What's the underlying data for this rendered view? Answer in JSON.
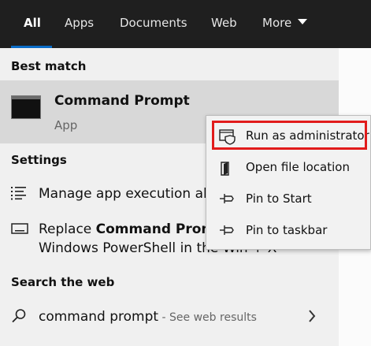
{
  "topbar": {
    "tabs": [
      "All",
      "Apps",
      "Documents",
      "Web",
      "More"
    ],
    "active_tab": "All",
    "accent_color": "#0a6cc7"
  },
  "best_match": {
    "header": "Best match",
    "title": "Command Prompt",
    "subtitle": "App",
    "icon": "command-prompt-icon"
  },
  "settings": {
    "header": "Settings",
    "items": [
      {
        "icon": "list-settings-icon",
        "text": "Manage app execution ali"
      },
      {
        "icon": "keyboard-icon",
        "text_prefix": "Replace ",
        "text_bold": "Command Promp",
        "line2": "Windows PowerShell in the Win + X"
      }
    ]
  },
  "web": {
    "header": "Search the web",
    "query": "command prompt",
    "suffix": " - See web results",
    "icon": "search-icon"
  },
  "context_menu": {
    "items": [
      {
        "label": "Run as administrator",
        "icon": "shield-window-icon",
        "highlighted": true
      },
      {
        "label": "Open file location",
        "icon": "file-location-icon"
      },
      {
        "label": "Pin to Start",
        "icon": "pin-icon"
      },
      {
        "label": "Pin to taskbar",
        "icon": "pin-icon"
      }
    ],
    "highlight_color": "#e11b1b"
  }
}
